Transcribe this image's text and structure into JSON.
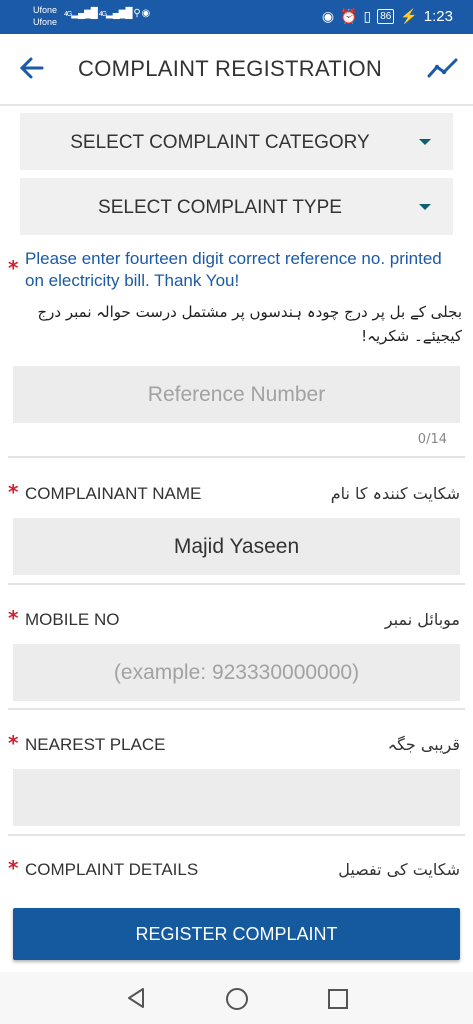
{
  "status_bar": {
    "carrier_1": "Ufone",
    "carrier_2": "Ufone",
    "network_1": "4G",
    "network_2": "4G",
    "battery": "86",
    "time": "1:23"
  },
  "app_bar": {
    "title": "COMPLAINT REGISTRATION"
  },
  "selects": {
    "category": "SELECT COMPLAINT CATEGORY",
    "type": "SELECT COMPLAINT TYPE"
  },
  "notice": {
    "english": "Please enter fourteen digit correct reference no. printed on electricity bill. Thank You!",
    "urdu": "بجلی کے بل پر درج چودہ ہندسوں پر مشتمل درست حوالہ نمبر درج کیجیئے۔ شکریہ!"
  },
  "reference": {
    "placeholder": "Reference Number",
    "counter": "0/14"
  },
  "complainant": {
    "label": "COMPLAINANT NAME",
    "label_urdu": "شکایت کنندہ کا نام",
    "value": "Majid Yaseen"
  },
  "mobile": {
    "label": "MOBILE NO",
    "label_urdu": "موبائل نمبر",
    "placeholder": "(example: 923330000000)"
  },
  "nearest_place": {
    "label": "NEAREST PLACE",
    "label_urdu": "قریبی جگہ",
    "value": ""
  },
  "details": {
    "label": "COMPLAINT DETAILS",
    "label_urdu": "شکایت کی تفصیل"
  },
  "register_button": "REGISTER COMPLAINT",
  "colors": {
    "primary": "#1b5aa6",
    "required": "#d21f2d",
    "field_bg": "#ececec"
  }
}
